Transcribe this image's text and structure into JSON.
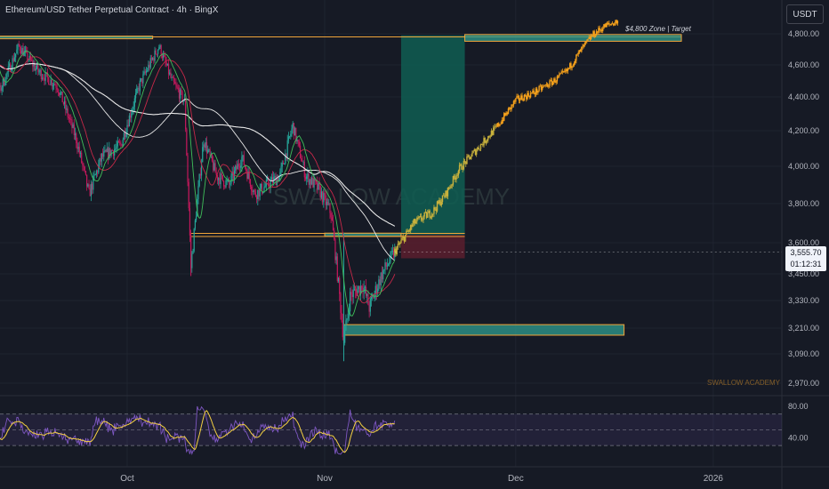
{
  "header": {
    "title": "Ethereum/USD Tether Perpetual Contract · 4h · BingX",
    "currency": "USDT"
  },
  "last_price": {
    "value": "3,555.70",
    "countdown": "01:12:31"
  },
  "watermark": "SWALLOW ACADEMY",
  "signature": "SWALLOW ACADEMY",
  "colors": {
    "bg": "#161a25",
    "up": "#26a69a",
    "down": "#c2185b",
    "projection": "#f7a21b",
    "zone": "#2f9c8f",
    "zone_border": "#f0a43a",
    "ma_white": "#e8e8e8",
    "ma_red": "#c62848",
    "ma_green": "#3fbf5a",
    "rsi": "#7e57c2",
    "rsi_ma": "#f5d142",
    "long_fill": "#0f5e52",
    "stop_fill": "#5a1f2e"
  },
  "chart_data": {
    "type": "candlestick",
    "y_axis": {
      "ticks": [
        4800,
        4600,
        4400,
        4200,
        4000,
        3800,
        3600,
        3450,
        3330,
        3210,
        3090,
        2970
      ],
      "tick_labels": [
        "4,800.00",
        "4,600.00",
        "4,400.00",
        "4,200.00",
        "4,000.00",
        "3,800.00",
        "3,600.00",
        "3,450.00",
        "3,330.00",
        "3,210.00",
        "3,090.00",
        "2,970.00"
      ]
    },
    "x_axis": {
      "ticks": [
        "2025-10-01",
        "2025-11-01",
        "2025-12-01",
        "2026-01-01"
      ],
      "tick_labels": [
        "Oct",
        "Nov",
        "Dec",
        "2026"
      ],
      "range": [
        "2025-09-06",
        "2026-01-11"
      ]
    },
    "rsi_axis": {
      "ticks": [
        80,
        40
      ],
      "tick_labels": [
        "80.00",
        "40.00"
      ],
      "range": [
        20,
        90
      ]
    },
    "price_path": [
      [
        "2025-09-07",
        4540
      ],
      [
        "2025-09-09",
        4710
      ],
      [
        "2025-09-11",
        4440
      ],
      [
        "2025-09-14",
        4720
      ],
      [
        "2025-09-17",
        4560
      ],
      [
        "2025-09-20",
        4470
      ],
      [
        "2025-09-23",
        4150
      ],
      [
        "2025-09-25",
        3850
      ],
      [
        "2025-09-27",
        4050
      ],
      [
        "2025-09-30",
        4120
      ],
      [
        "2025-10-03",
        4480
      ],
      [
        "2025-10-06",
        4720
      ],
      [
        "2025-10-08",
        4500
      ],
      [
        "2025-10-10",
        4370
      ],
      [
        "2025-10-11",
        3480
      ],
      [
        "2025-10-13",
        4150
      ],
      [
        "2025-10-15",
        3950
      ],
      [
        "2025-10-17",
        3900
      ],
      [
        "2025-10-19",
        4050
      ],
      [
        "2025-10-21",
        3850
      ],
      [
        "2025-10-23",
        3900
      ],
      [
        "2025-10-25",
        3950
      ],
      [
        "2025-10-27",
        4230
      ],
      [
        "2025-10-29",
        3950
      ],
      [
        "2025-10-31",
        3880
      ],
      [
        "2025-11-02",
        3750
      ],
      [
        "2025-11-03",
        3450
      ],
      [
        "2025-11-04",
        3150
      ],
      [
        "2025-11-05",
        3350
      ],
      [
        "2025-11-07",
        3400
      ],
      [
        "2025-11-08",
        3300
      ],
      [
        "2025-11-10",
        3450
      ],
      [
        "2025-11-12",
        3556
      ]
    ],
    "projection_path": [
      [
        "2025-11-12",
        3556
      ],
      [
        "2025-11-15",
        3700
      ],
      [
        "2025-11-18",
        3760
      ],
      [
        "2025-11-20",
        3850
      ],
      [
        "2025-11-22",
        3980
      ],
      [
        "2025-11-25",
        4100
      ],
      [
        "2025-11-28",
        4220
      ],
      [
        "2025-12-01",
        4380
      ],
      [
        "2025-12-04",
        4430
      ],
      [
        "2025-12-07",
        4500
      ],
      [
        "2025-12-09",
        4560
      ],
      [
        "2025-12-11",
        4680
      ],
      [
        "2025-12-13",
        4790
      ],
      [
        "2025-12-15",
        4850
      ],
      [
        "2025-12-17",
        4880
      ]
    ],
    "zones": [
      {
        "from": "2025-09-06",
        "to": "2025-10-05",
        "low": 4770,
        "high": 4785
      },
      {
        "from": "2025-11-23",
        "to": "2025-12-27",
        "low": 4752,
        "high": 4795
      },
      {
        "from": "2025-11-01",
        "to": "2025-11-13",
        "low": 3633,
        "high": 3649
      },
      {
        "from": "2025-11-04",
        "to": "2025-12-18",
        "low": 3177,
        "high": 3225
      }
    ],
    "levels": [
      {
        "value": 4780,
        "from": "2025-09-06",
        "to": "2025-12-27"
      },
      {
        "value": 3648,
        "from": "2025-10-11",
        "to": "2025-11-23"
      },
      {
        "value": 3632,
        "from": "2025-10-11",
        "to": "2025-11-23"
      }
    ],
    "target_label": "$4,800 Zone | Target",
    "position": {
      "from": "2025-11-13",
      "to": "2025-11-23",
      "entry": 3640,
      "target": 4790,
      "stop": 3525
    },
    "last_price": 3555.7
  }
}
